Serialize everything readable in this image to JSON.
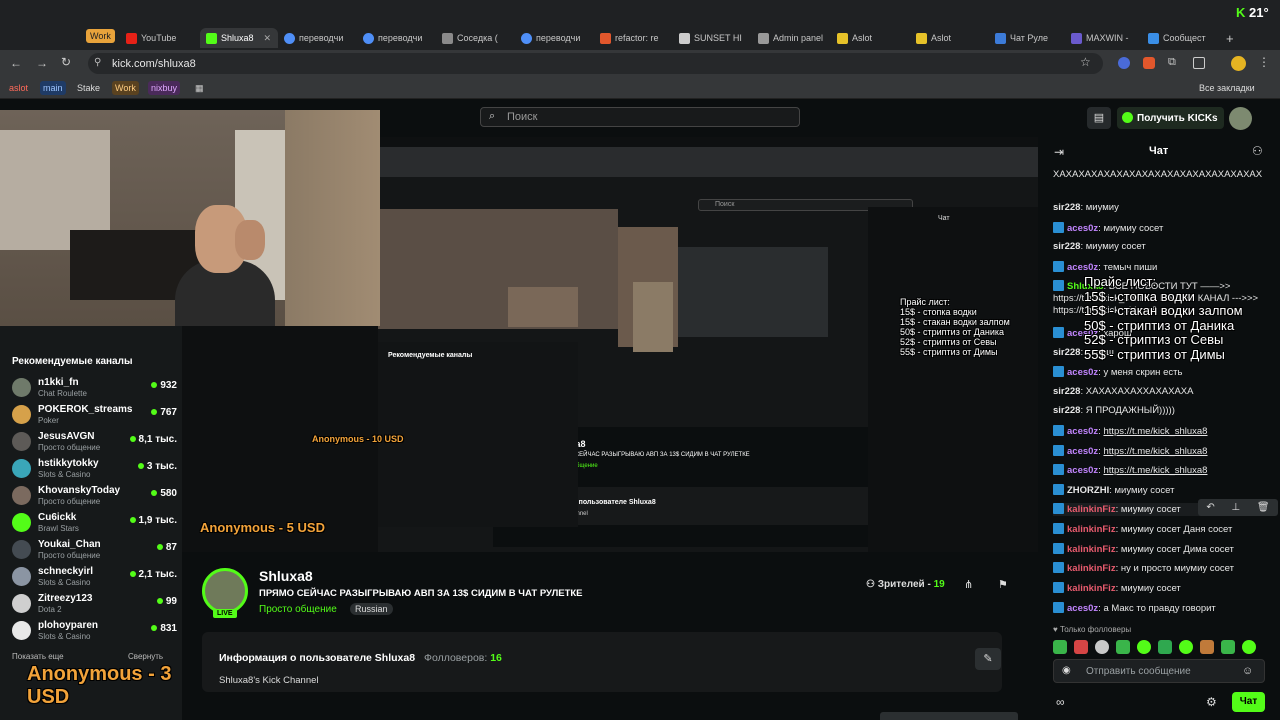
{
  "browser": {
    "tabs": [
      {
        "label": "Work",
        "color": "#e8a33b"
      },
      {
        "label": "YouTube",
        "color": "#e62117"
      },
      {
        "label": "Shluxa8",
        "color": "#53fc18"
      },
      {
        "label": "переводчи",
        "color": "#4f8ff7"
      },
      {
        "label": "переводчи",
        "color": "#4f8ff7"
      },
      {
        "label": "Соседка (",
        "color": "#8a8a8a"
      },
      {
        "label": "переводчи",
        "color": "#4f8ff7"
      },
      {
        "label": "refactor: re",
        "color": "#e2572c"
      },
      {
        "label": "SUNSET HI",
        "color": "#cccccc"
      },
      {
        "label": "Admin panel",
        "color": "#999999"
      },
      {
        "label": "Aslot",
        "color": "#e6c229"
      },
      {
        "label": "Aslot",
        "color": "#e6c229"
      },
      {
        "label": "Чат Руле",
        "color": "#3c7bd8"
      },
      {
        "label": "MAXWIN -",
        "color": "#6a5acd"
      },
      {
        "label": "Сообщест",
        "color": "#3a8ee6"
      }
    ],
    "url": "kick.com/shluxa8",
    "bookmarks": [
      {
        "label": "aslot",
        "bg": "#3a2a2a",
        "fg": "#ff6a5a"
      },
      {
        "label": "main",
        "bg": "#1f3b66",
        "fg": "#9cc4ff"
      },
      {
        "label": "Stake",
        "bg": "transparent",
        "fg": "#dddddd"
      },
      {
        "label": "Work",
        "bg": "#5a4220",
        "fg": "#ffcc80"
      },
      {
        "label": "nixbuy",
        "bg": "#4a2a5a",
        "fg": "#e0a8ff"
      }
    ],
    "all_bookmarks": "Все закладки",
    "k_badge": "21°"
  },
  "header": {
    "search_placeholder": "Поиск",
    "get_kicks": "Получить KICKs"
  },
  "sidebar": {
    "title": "Рекомендуемые каналы",
    "channels": [
      {
        "name": "n1kki_fn",
        "category": "Chat Roulette",
        "viewers": "932",
        "avatar": "#6f7a6a"
      },
      {
        "name": "POKEROK_streams",
        "category": "Poker",
        "viewers": "767",
        "avatar": "#d6a14a"
      },
      {
        "name": "JesusAVGN",
        "category": "Просто общение",
        "viewers": "8,1 тыс.",
        "avatar": "#5d5a57"
      },
      {
        "name": "hstikkytokky",
        "category": "Slots & Casino",
        "viewers": "3 тыс.",
        "avatar": "#3aa6b9"
      },
      {
        "name": "KhovanskyToday",
        "category": "Просто общение",
        "viewers": "580",
        "avatar": "#7b6a5f"
      },
      {
        "name": "Cu6ickk",
        "category": "Brawl Stars",
        "viewers": "1,9 тыс.",
        "avatar": "#53fc18"
      },
      {
        "name": "Youkai_Chan",
        "category": "Просто общение",
        "viewers": "87",
        "avatar": "#444b52"
      },
      {
        "name": "schneckyirl",
        "category": "Slots & Casino",
        "viewers": "2,1 тыс.",
        "avatar": "#8b95a3"
      },
      {
        "name": "Zitreezy123",
        "category": "Dota 2",
        "viewers": "99",
        "avatar": "#cfcfcf"
      },
      {
        "name": "plohoyparen",
        "category": "Slots & Casino",
        "viewers": "831",
        "avatar": "#e8e8e8"
      }
    ],
    "show_more": "Показать еще",
    "collapse": "Свернуть",
    "donation_overlay": "Anonymous - 3 USD"
  },
  "player": {
    "donation_overlay_1": "Anonymous - 10 USD",
    "donation_overlay_2": "Anonymous - 5 USD",
    "playlist_overlay": [
      "Прайс лист:",
      "15$ - стопка водки",
      "15$ - стакан водки залпом",
      "50$ - стриптиз от Даника",
      "52$ - стриптиз от Севы",
      "55$ - стриптиз от Димы"
    ]
  },
  "channel": {
    "name": "Shluxa8",
    "title": "ПРЯМО СЕЙЧАС РАЗЫГРЫВАЮ АВП ЗА 13$ СИДИМ В ЧАТ РУЛЕТКЕ",
    "category": "Просто общение",
    "language": "Russian",
    "live": "LIVE",
    "viewers_label": "Зрителей -",
    "viewers": "19",
    "about_title": "Информация о пользователе Shluxa8",
    "followers_label": "Фолловеров:",
    "followers": "16",
    "about_desc": "Shluxa8's Kick Channel"
  },
  "chat": {
    "title": "Чат",
    "messages": [
      {
        "user": "",
        "text": "ХАХАХАХАХАХАХАХАХАХАХАХАХАХАХАХАХ",
        "badge": false,
        "color": "#e6e6e6"
      },
      {
        "user": "sir228",
        "text": "миумиу",
        "badge": false,
        "color": "#e6e6e6"
      },
      {
        "user": "aces0z",
        "text": "миумиу сосет",
        "badge": true,
        "color": "#c084fc"
      },
      {
        "user": "sir228",
        "text": "миумиу сосет",
        "badge": false,
        "color": "#e6e6e6"
      },
      {
        "user": "aces0z",
        "text": "темыч пиши",
        "badge": true,
        "color": "#c084fc"
      },
      {
        "user": "Shluxa8",
        "text": "ВСЕ НОВОСТИ ТУТ ——>> https://t.me/kick_shluxa8 НАШ ТГ КАНАЛ --->>> https://t.me/kick_shluxa8",
        "badge": true,
        "color": "#53fc18"
      },
      {
        "user": "aces0z",
        "text": "харош",
        "badge": true,
        "color": "#c084fc"
      },
      {
        "user": "sir228",
        "text": "харош",
        "badge": false,
        "color": "#e6e6e6"
      },
      {
        "user": "aces0z",
        "text": "у меня скрин есть",
        "badge": true,
        "color": "#c084fc"
      },
      {
        "user": "sir228",
        "text": "ХАХАХАХАХХАХАХАХА",
        "badge": false,
        "color": "#e6e6e6"
      },
      {
        "user": "sir228",
        "text": "Я ПРОДАЖНЫЙ)))))",
        "badge": false,
        "color": "#e6e6e6"
      },
      {
        "user": "aces0z",
        "text": "https://t.me/kick_shluxa8",
        "badge": true,
        "color": "#c084fc",
        "link": true
      },
      {
        "user": "aces0z",
        "text": "https://t.me/kick_shluxa8",
        "badge": true,
        "color": "#c084fc",
        "link": true
      },
      {
        "user": "aces0z",
        "text": "https://t.me/kick_shluxa8",
        "badge": true,
        "color": "#c084fc",
        "link": true
      },
      {
        "user": "ZHORZHI",
        "text": "миумиу сосет",
        "badge": true,
        "color": "#e6e6e6"
      },
      {
        "user": "kalinkinFiz",
        "text": "миумиу сосет",
        "badge": true,
        "color": "#e85b6e"
      },
      {
        "user": "kalinkinFiz",
        "text": "миумиу сосет Даня сосет",
        "badge": true,
        "color": "#e85b6e"
      },
      {
        "user": "kalinkinFiz",
        "text": "миумиу сосет Дима сосет",
        "badge": true,
        "color": "#e85b6e"
      },
      {
        "user": "kalinkinFiz",
        "text": "ну и просто миумиу сосет",
        "badge": true,
        "color": "#e85b6e"
      },
      {
        "user": "kalinkinFiz",
        "text": "миумиу сосет",
        "badge": true,
        "color": "#e85b6e"
      },
      {
        "user": "aces0z",
        "text": "а Макс то правду говорит",
        "badge": true,
        "color": "#c084fc"
      }
    ],
    "followers_only": "Только фолловеры",
    "input_placeholder": "Отправить сообщение",
    "send_button": "Чат",
    "pinned_overlay": [
      "Прайс лист:",
      "15$ - стопка водки",
      "15$ - стакан водки залпом",
      "50$ - стриптиз от Даника",
      "52$ - стриптиз от Севы",
      "55$ - стриптиз от Димы"
    ]
  }
}
